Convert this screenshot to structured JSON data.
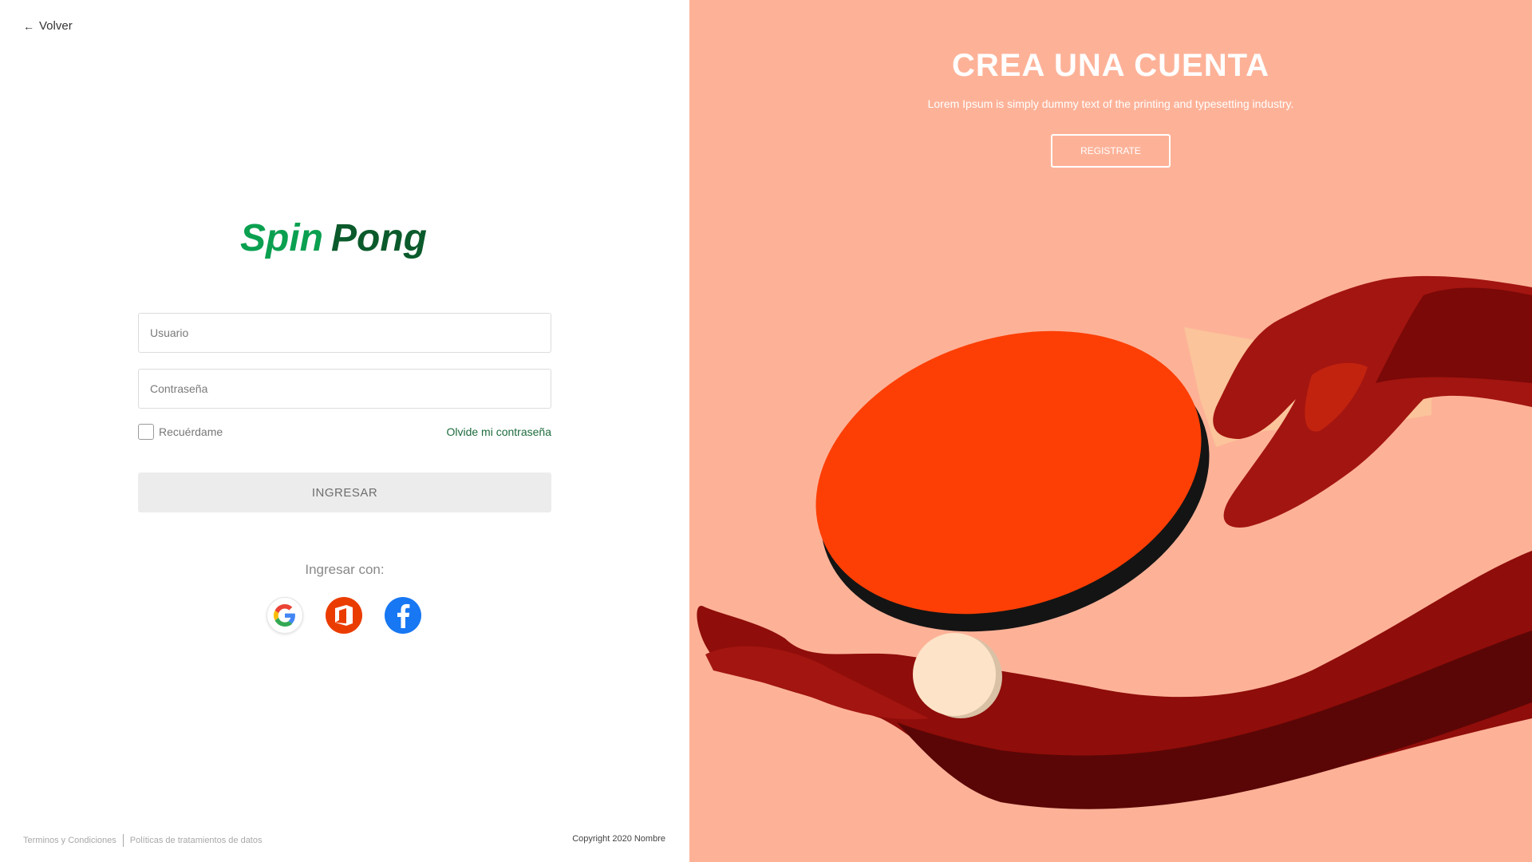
{
  "nav": {
    "back_label": "Volver"
  },
  "brand": {
    "logo_text": "SpinPong",
    "colors": {
      "spin": "#0aa050",
      "pong": "#0b5a2b"
    }
  },
  "form": {
    "username_placeholder": "Usuario",
    "password_placeholder": "Contraseña",
    "remember_label": "Recuérdame",
    "forgot_label": "Olvide mi contraseña",
    "submit_label": "INGRESAR"
  },
  "social": {
    "heading": "Ingresar con:",
    "providers": [
      "google",
      "office",
      "facebook"
    ]
  },
  "footer": {
    "terms": "Terminos y Condiciones",
    "privacy": "Políticas de tratamientos de datos",
    "copyright": "Copyright 2020 Nombre"
  },
  "promo": {
    "headline": "CREA UNA CUENTA",
    "subtext": "Lorem Ipsum is simply dummy text of the printing and typesetting industry.",
    "register_label": "REGISTRATE",
    "background": "#fdb298"
  }
}
